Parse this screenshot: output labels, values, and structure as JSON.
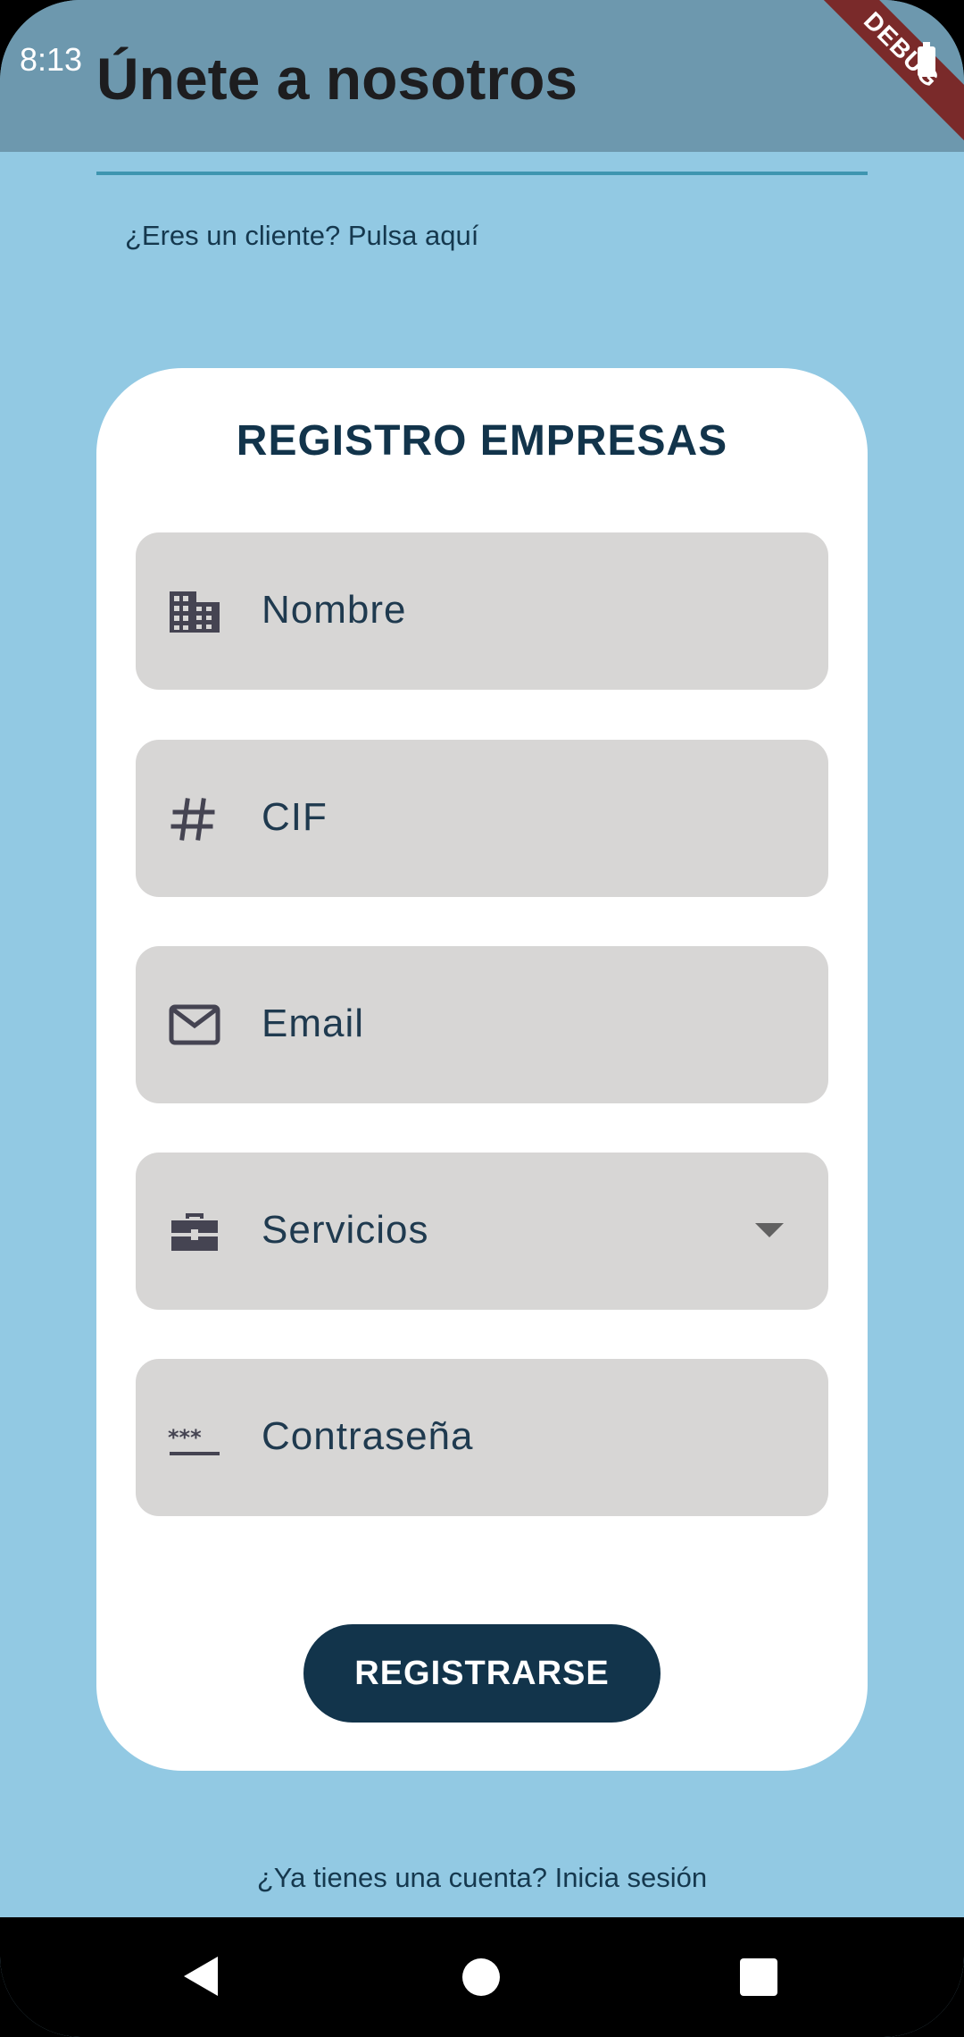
{
  "status": {
    "time": "8:13"
  },
  "appbar": {
    "title": "Únete a nosotros",
    "debug_label": "DEBUG"
  },
  "client_link": "¿Eres un cliente? Pulsa aquí",
  "card": {
    "title": "REGISTRO EMPRESAS",
    "fields": [
      {
        "label": "Nombre",
        "icon": "business-icon"
      },
      {
        "label": "CIF",
        "icon": "hash-icon"
      },
      {
        "label": "Email",
        "icon": "mail-icon"
      },
      {
        "label": "Servicios",
        "icon": "briefcase-icon",
        "type": "dropdown"
      },
      {
        "label": "Contraseña",
        "icon": "password-icon"
      }
    ],
    "submit_label": "REGISTRARSE"
  },
  "login_link": "¿Ya tienes una cuenta? Inicia sesión",
  "colors": {
    "background": "#92c9e3",
    "appbar": "#6d98ae",
    "primary": "#12344b",
    "field": "#d7d6d5"
  }
}
